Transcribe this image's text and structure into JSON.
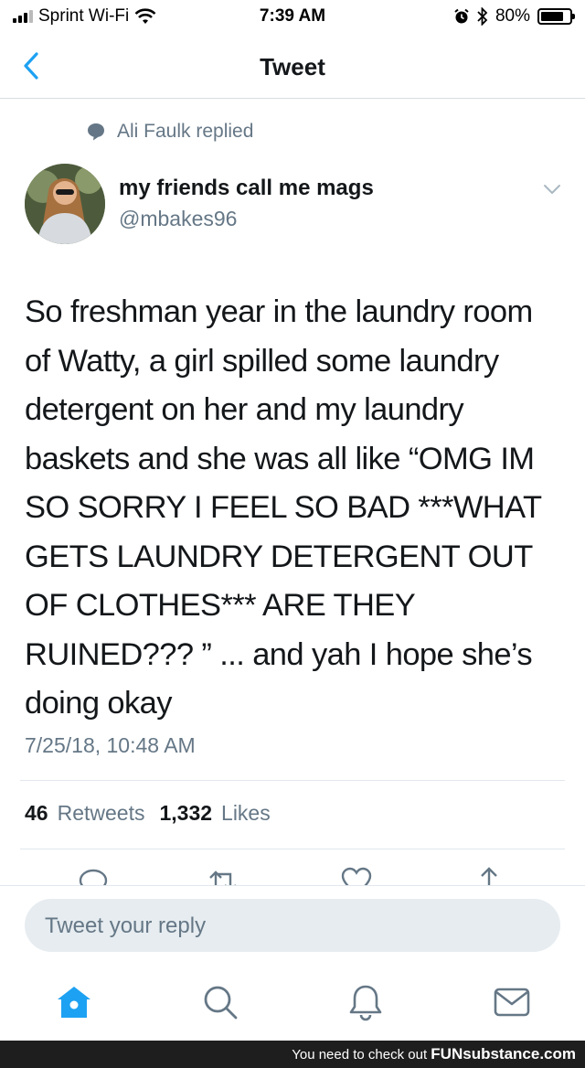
{
  "status_bar": {
    "carrier": "Sprint Wi-Fi",
    "time": "7:39 AM",
    "battery": "80%",
    "battery_level": 0.8
  },
  "nav": {
    "title": "Tweet"
  },
  "context": {
    "replied_text": "Ali Faulk replied"
  },
  "author": {
    "name": "my friends call me mags",
    "handle": "@mbakes96"
  },
  "tweet": {
    "text": "So freshman year in the laundry room\nof Watty, a girl spilled some laundry\ndetergent on her and my laundry\nbaskets and she was all like “OMG IM\nSO SORRY I FEEL SO BAD ***WHAT\nGETS LAUNDRY DETERGENT OUT\nOF CLOTHES*** ARE THEY\nRUINED??? ” ... and yah I hope she’s\ndoing okay",
    "timestamp": "7/25/18, 10:48 AM"
  },
  "stats": {
    "retweets_count": "46",
    "retweets_label": "Retweets",
    "likes_count": "1,332",
    "likes_label": "Likes"
  },
  "reply": {
    "placeholder": "Tweet your reply"
  },
  "colors": {
    "accent": "#1da1f2",
    "secondary_text": "#657786",
    "primary_text": "#14171a"
  },
  "icons": {
    "back": "chevron-left-icon",
    "reply_context": "speech-bubble-icon",
    "caret": "chevron-down-icon",
    "tabs": [
      "home-icon",
      "search-icon",
      "bell-icon",
      "mail-icon"
    ]
  },
  "watermark": {
    "prefix": "You need to check out",
    "brand": "FUNsubstance.com"
  }
}
